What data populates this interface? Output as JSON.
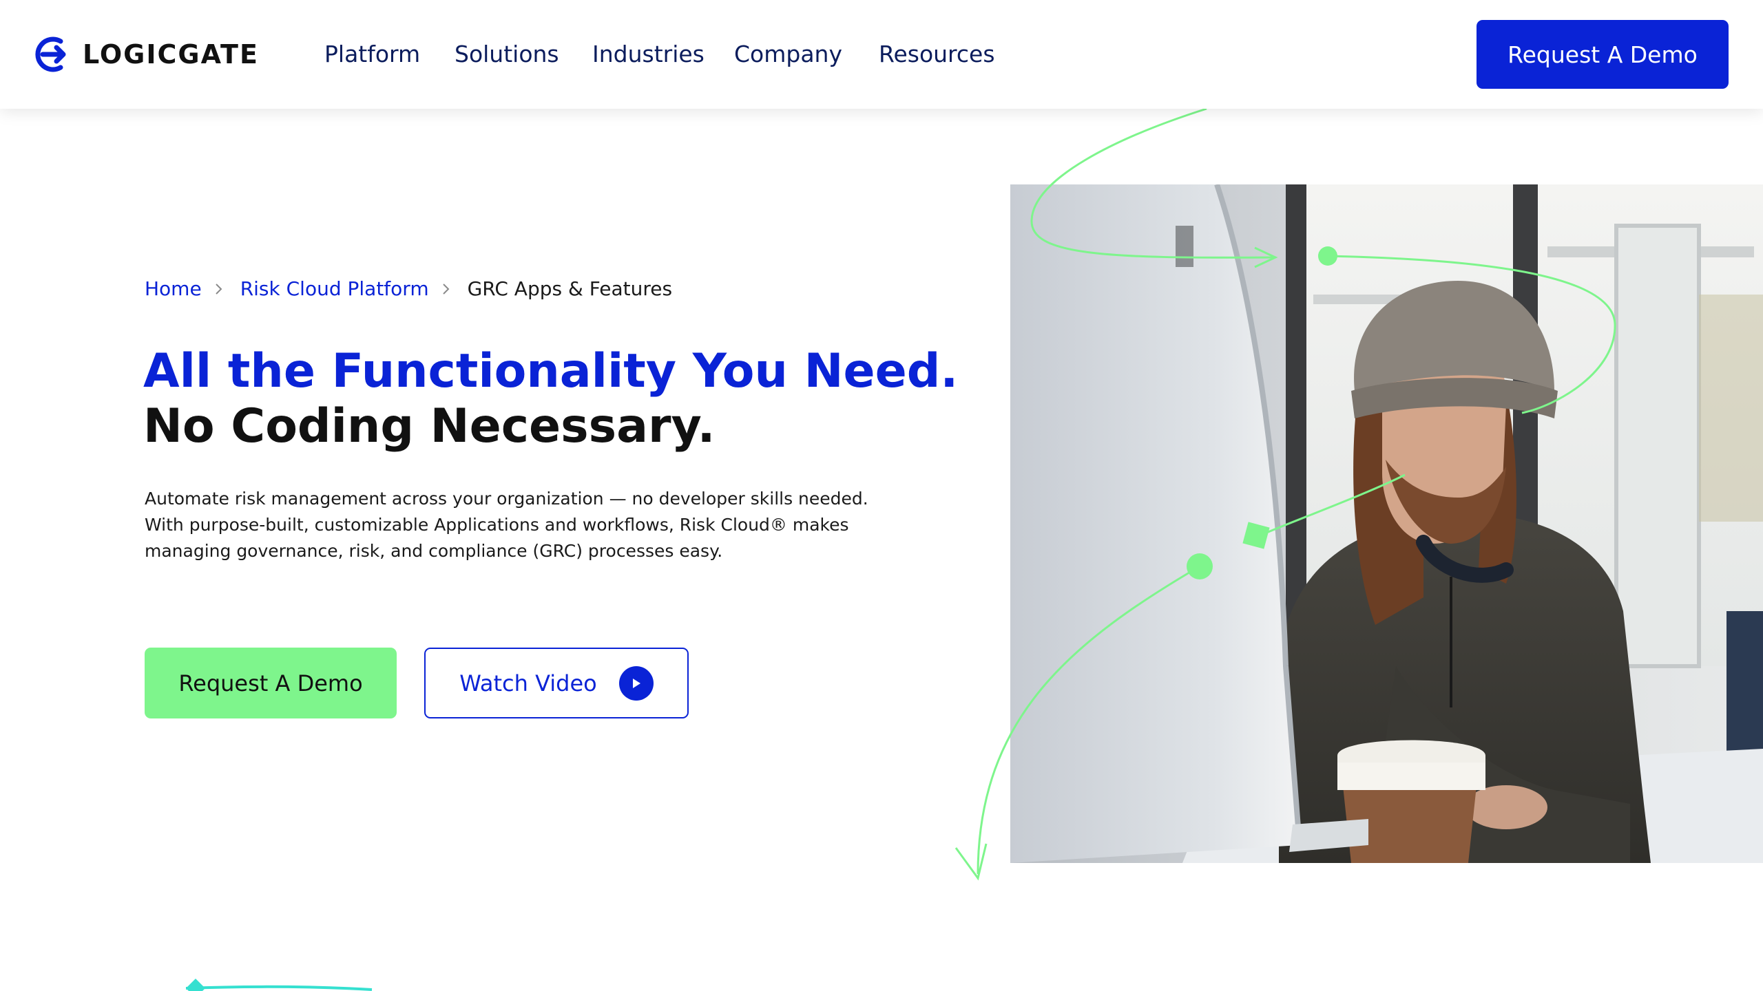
{
  "header": {
    "logo_text": "LOGICGATE",
    "nav": [
      "Platform",
      "Solutions",
      "Industries",
      "Company",
      "Resources"
    ],
    "cta_label": "Request A Demo"
  },
  "breadcrumb": {
    "home": "Home",
    "parent": "Risk Cloud Platform",
    "current": "GRC Apps & Features"
  },
  "hero": {
    "headline_line1": "All the Functionality You Need.",
    "headline_line2": "No Coding Necessary.",
    "body_line1": "Automate risk management across your organization — no developer skills needed.",
    "body_line2": "With purpose-built, customizable Applications and workflows, Risk Cloud® makes",
    "body_line3": "managing governance, risk, and compliance (GRC) processes easy.",
    "primary_cta": "Request A Demo",
    "secondary_cta": "Watch Video"
  },
  "colors": {
    "brand_blue": "#0a23d6",
    "nav_text": "#0b1c5c",
    "accent_green": "#7ef58c",
    "decor_cyan": "#35e0d0"
  }
}
